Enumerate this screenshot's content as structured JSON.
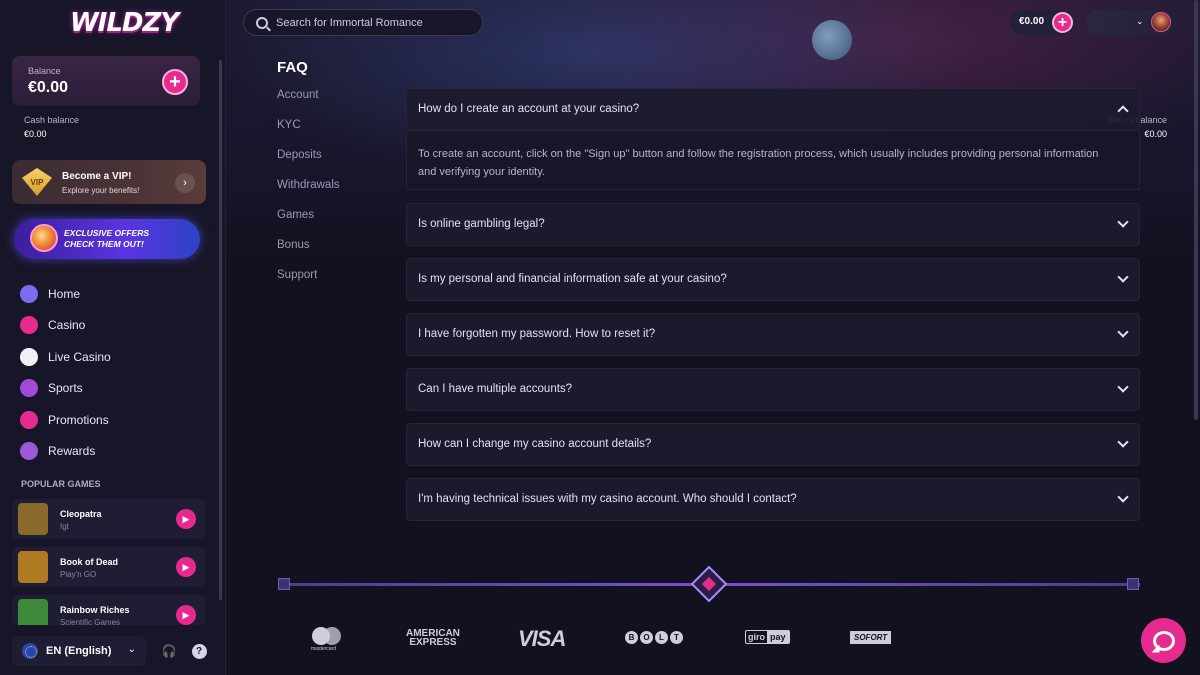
{
  "brand": {
    "logo_text": "WILDZY"
  },
  "sidebar": {
    "balance_label": "Balance",
    "balance_value": "€0.00",
    "cash_label": "Cash balance",
    "cash_value": "€0.00",
    "bonus_label": "Bonus balance",
    "bonus_value": "€0.00",
    "vip_badge": "VIP",
    "vip_title": "Become a VIP!",
    "vip_subtitle": "Explore your benefits!",
    "offers_text": "EXCLUSIVE OFFERS CHECK THEM OUT!",
    "nav": [
      {
        "label": "Home",
        "icon": "home-icon",
        "color": "#7b6cf0"
      },
      {
        "label": "Casino",
        "icon": "casino-chip-icon",
        "color": "#e72a8d"
      },
      {
        "label": "Live Casino",
        "icon": "cards-icon",
        "color": "#f2f0f7"
      },
      {
        "label": "Sports",
        "icon": "soccer-ball-icon",
        "color": "#a04ad8"
      },
      {
        "label": "Promotions",
        "icon": "diamond-icon",
        "color": "#e72a8d"
      },
      {
        "label": "Rewards",
        "icon": "star-icon",
        "color": "#9b59d8"
      }
    ],
    "popular_title": "POPULAR GAMES",
    "games": [
      {
        "name": "Cleopatra",
        "provider": "Igt",
        "thumb": "#8a6a2a"
      },
      {
        "name": "Book of Dead",
        "provider": "Play'n GO",
        "thumb": "#b07a22"
      },
      {
        "name": "Rainbow Riches",
        "provider": "Scientific Games",
        "thumb": "#3d8a3a"
      }
    ],
    "language": "EN (English)"
  },
  "topbar": {
    "search_placeholder": "Search for Immortal Romance",
    "balance": "€0.00"
  },
  "faq": {
    "title": "FAQ",
    "categories": [
      "Account",
      "KYC",
      "Deposits",
      "Withdrawals",
      "Games",
      "Bonus",
      "Support"
    ],
    "items": [
      {
        "question": "How do I create an account at your casino?",
        "expanded": true,
        "answer": "To create an account, click on the \"Sign up\" button and follow the registration process, which usually includes providing personal information and verifying your identity."
      },
      {
        "question": "Is online gambling legal?",
        "expanded": false
      },
      {
        "question": "Is my personal and financial information safe at your casino?",
        "expanded": false
      },
      {
        "question": "I have forgotten my password. How to reset it?",
        "expanded": false
      },
      {
        "question": "Can I have multiple accounts?",
        "expanded": false
      },
      {
        "question": "How can I change my casino account details?",
        "expanded": false
      },
      {
        "question": "I'm having technical issues with my casino account. Who should I contact?",
        "expanded": false
      }
    ]
  },
  "payments": {
    "mastercard": "mastercard",
    "amex_line1": "AMERICAN",
    "amex_line2": "EXPRESS",
    "visa": "VISA",
    "bolt": [
      "B",
      "O",
      "L",
      "T"
    ],
    "giropay_a": "giro",
    "giropay_b": "pay",
    "sofort": "SOFORT"
  },
  "colors": {
    "accent": "#e72a8d",
    "background": "#12111f",
    "sidebar": "#171628"
  }
}
